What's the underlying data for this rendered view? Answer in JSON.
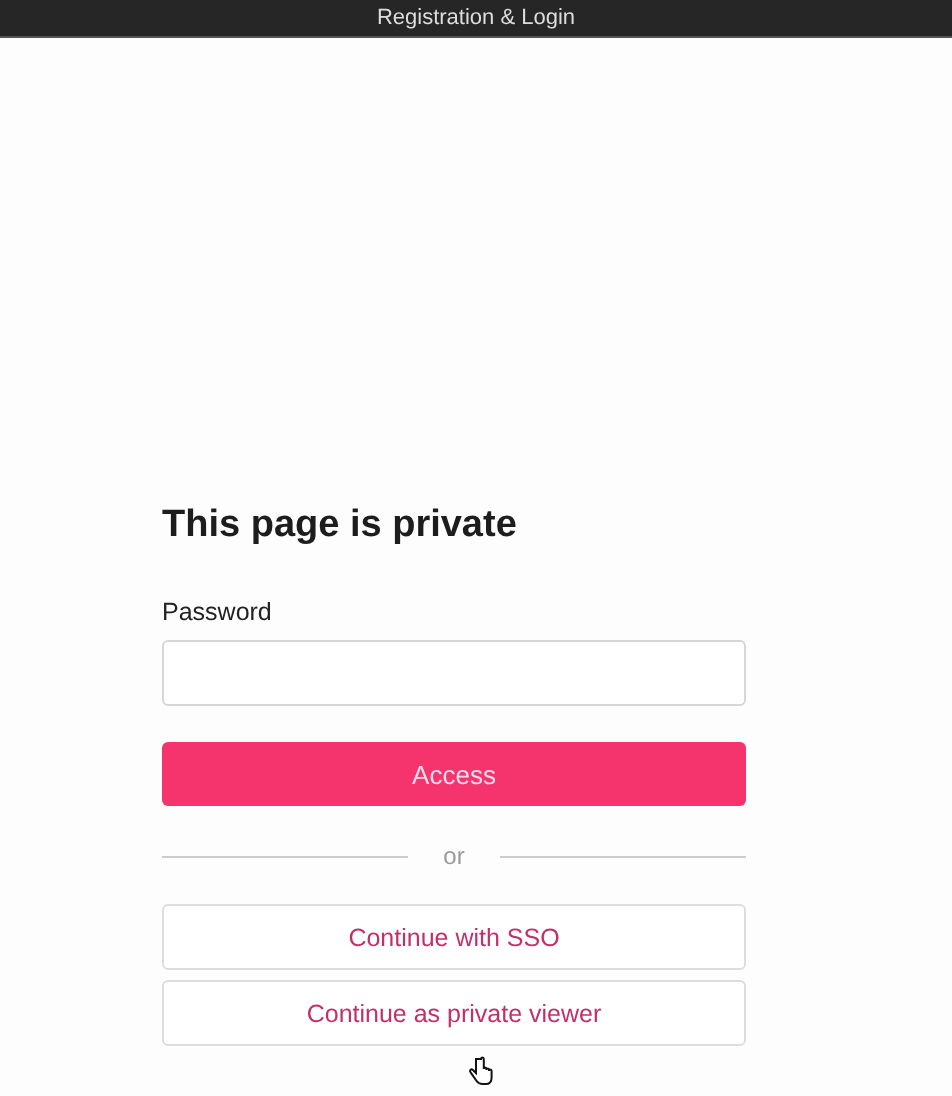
{
  "window": {
    "title": "Registration & Login"
  },
  "heading": "This page is private",
  "password": {
    "label": "Password"
  },
  "primary_button": "Access",
  "divider": "or",
  "secondary_buttons": [
    "Continue with SSO",
    "Continue as private viewer"
  ]
}
